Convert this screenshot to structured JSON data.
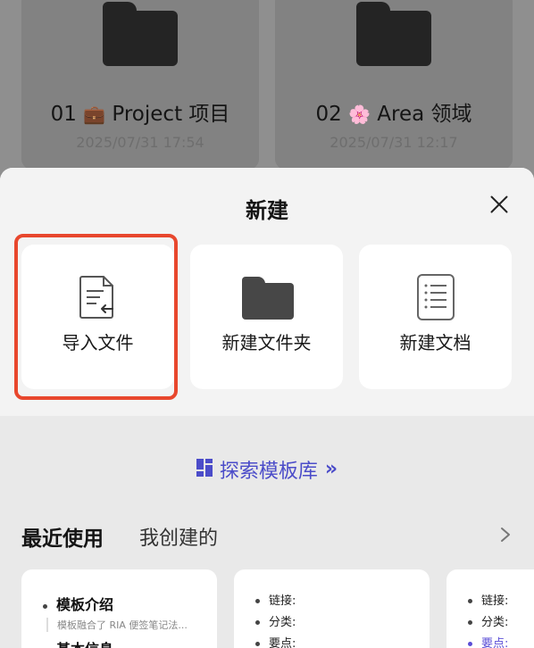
{
  "background_folders": [
    {
      "number": "01",
      "emoji": "💼",
      "name": "Project 项目",
      "date": "2025/07/31 17:54"
    },
    {
      "number": "02",
      "emoji": "🌸",
      "name": "Area 领域",
      "date": "2025/07/31 12:17"
    }
  ],
  "sheet": {
    "title": "新建",
    "actions": [
      {
        "label": "导入文件",
        "icon": "import-file-icon"
      },
      {
        "label": "新建文件夹",
        "icon": "folder-icon"
      },
      {
        "label": "新建文档",
        "icon": "document-icon"
      }
    ],
    "explore_label": "探索模板库",
    "explore_arrow": "»",
    "tabs": {
      "recent": "最近使用",
      "mine": "我创建的"
    },
    "templates": [
      {
        "title": "模板介绍",
        "subtitle": "模板融合了 RIA 便签笔记法...",
        "title2": "基本信息"
      },
      {
        "lines": [
          "链接:",
          "分类:",
          "要点:"
        ]
      },
      {
        "lines": [
          "链接:",
          "分类:"
        ],
        "accent_line": "要点:"
      }
    ]
  },
  "colors": {
    "accent": "#4b4cc9",
    "highlight": "#e8472d"
  }
}
